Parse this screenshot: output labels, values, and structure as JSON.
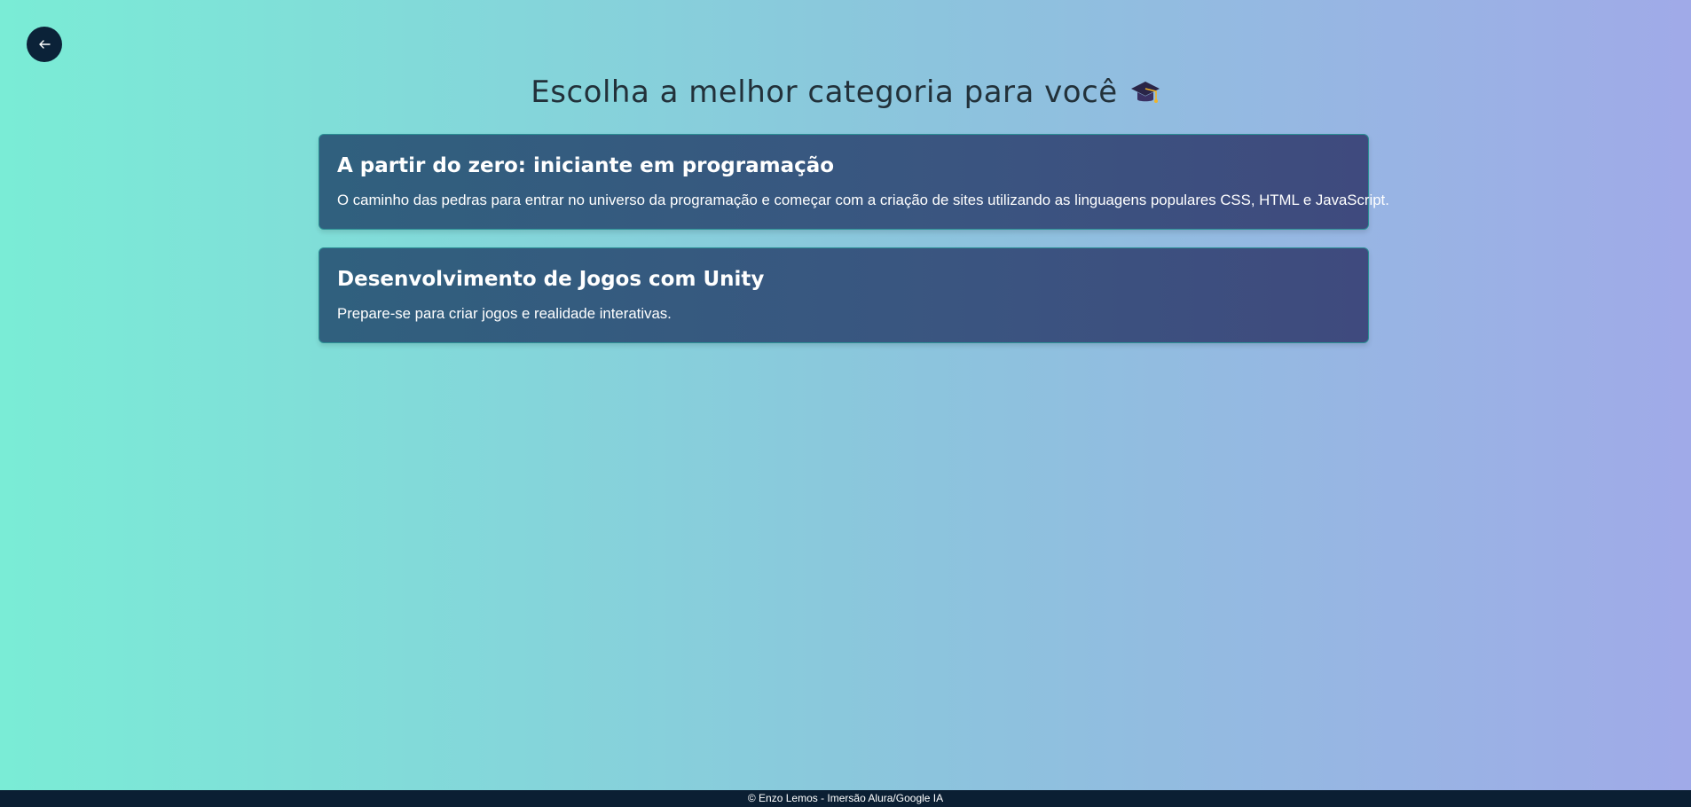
{
  "header": {
    "back_button": {
      "icon": "arrow-left-icon"
    },
    "title": "Escolha a melhor categoria para você",
    "title_emoji": "graduation-cap-icon"
  },
  "categories": [
    {
      "title": "A partir do zero: iniciante em programação",
      "description": "O caminho das pedras para entrar no universo da programação e começar com a criação de sites utilizando as linguagens populares CSS, HTML e JavaScript."
    },
    {
      "title": "Desenvolvimento de Jogos com Unity",
      "description": "Prepare-se para criar jogos e realidade interativas."
    }
  ],
  "footer": {
    "text": "© Enzo Lemos - Imersão Alura/Google IA"
  },
  "colors": {
    "background_start": "#7aecd6",
    "background_end": "#a0aae8",
    "card_start": "#30607e",
    "card_end": "#3f4a7e",
    "footer_bg": "#0b1f33",
    "back_button_bg": "#0b2238"
  }
}
